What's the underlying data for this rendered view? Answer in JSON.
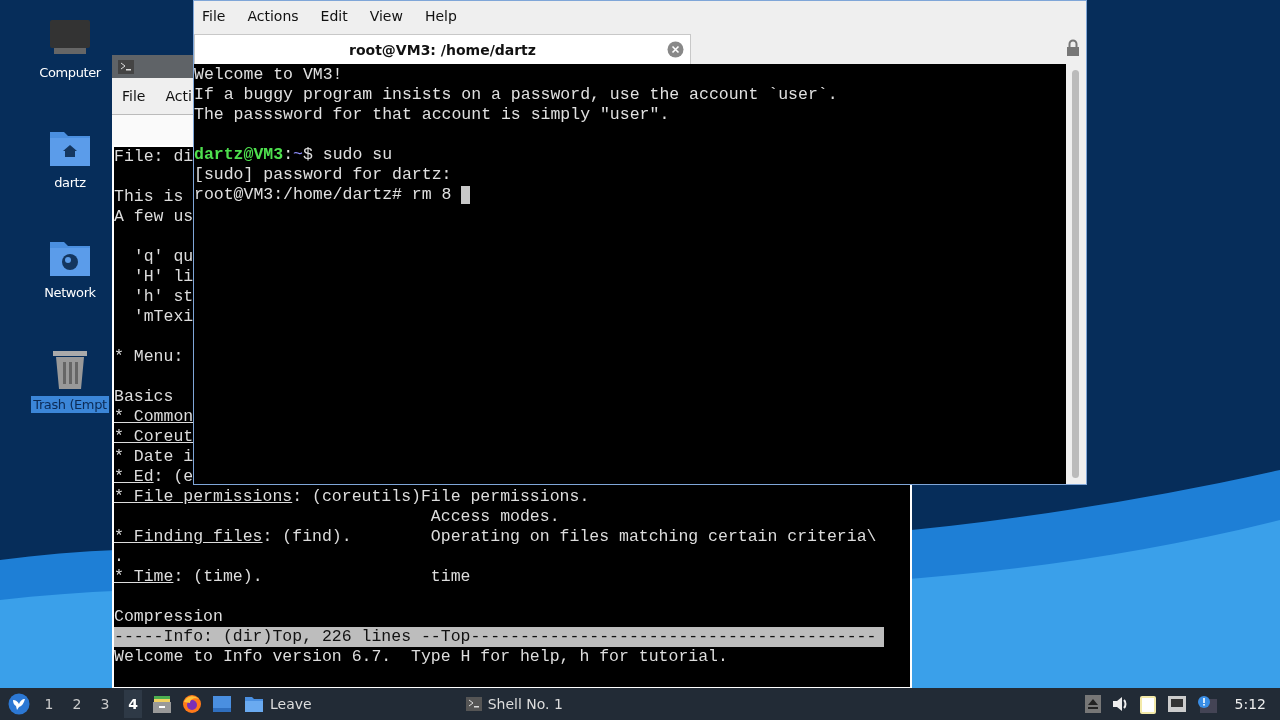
{
  "desktop_icons": [
    {
      "label": "Computer",
      "kind": "computer",
      "selected": false
    },
    {
      "label": "dartz",
      "kind": "home",
      "selected": false
    },
    {
      "label": "Network",
      "kind": "network",
      "selected": false
    },
    {
      "label": "Trash (Empt",
      "kind": "trash",
      "selected": true
    }
  ],
  "back_window": {
    "menu": [
      "File",
      "Acti"
    ],
    "blocks": [
      [
        {
          "text": "File: di"
        }
      ],
      [
        {
          "text": "This is "
        },
        {
          "text": "A few us"
        }
      ],
      [
        {
          "text": "  'q' qu"
        },
        {
          "text": "  'H' li"
        },
        {
          "text": "  'h' st"
        },
        {
          "text": "  'mTexi"
        }
      ],
      [
        {
          "text": "* Menu: "
        }
      ],
      [
        {
          "text": "Basics"
        },
        {
          "link": "* Common"
        },
        {
          "link": "* Coreut"
        },
        {
          "text": "* Date i"
        },
        {
          "link": "* Ed",
          "text": ": (e"
        },
        {
          "link": "* File permissions",
          "text": ": (coreutils)File permissions."
        },
        {
          "text": "                                Access modes."
        },
        {
          "link": "* Finding files",
          "text": ": (find).        Operating on files matching certain criteria\\"
        },
        {
          "text": "."
        },
        {
          "link": "* Time",
          "text": ": (time).                 time"
        }
      ],
      [
        {
          "text": "Compression"
        },
        {
          "text": "-----Info: (dir)Top, 226 lines --Top-----------------------------------------",
          "kind": "status"
        },
        {
          "text": "Welcome to Info version 6.7.  Type H for help, h for tutorial."
        }
      ]
    ]
  },
  "front_window": {
    "menu": [
      "File",
      "Actions",
      "Edit",
      "View",
      "Help"
    ],
    "tab": {
      "title": "root@VM3: /home/dartz",
      "selected": true
    },
    "blocks": [
      [
        {
          "segments": [
            {
              "text": "Welcome to VM3!",
              "kind": "plain"
            }
          ]
        },
        {
          "segments": [
            {
              "text": "If a buggy program insists on a password, use the account `user`.",
              "kind": "plain"
            }
          ]
        },
        {
          "segments": [
            {
              "text": "The passsword for that account is simply \"user\".",
              "kind": "plain"
            }
          ]
        }
      ],
      [
        {
          "segments": [
            {
              "text": "dartz@VM3",
              "kind": "user"
            },
            {
              "text": ":",
              "kind": "plain"
            },
            {
              "text": "~",
              "kind": "path"
            },
            {
              "text": "$ sudo su",
              "kind": "plain"
            }
          ]
        },
        {
          "segments": [
            {
              "text": "[sudo] password for dartz:",
              "kind": "plain"
            }
          ]
        },
        {
          "segments": [
            {
              "text": "root@VM3:/home/dartz# rm 8 ",
              "kind": "plain"
            }
          ],
          "cursor": true
        }
      ]
    ]
  },
  "taskbar": {
    "workspaces": [
      {
        "label": "1",
        "selected": false
      },
      {
        "label": "2",
        "selected": false
      },
      {
        "label": "3",
        "selected": false
      },
      {
        "label": "4",
        "selected": true
      }
    ],
    "launcher_label": "Leave",
    "task": "Shell No. 1",
    "clock": "5:12"
  }
}
